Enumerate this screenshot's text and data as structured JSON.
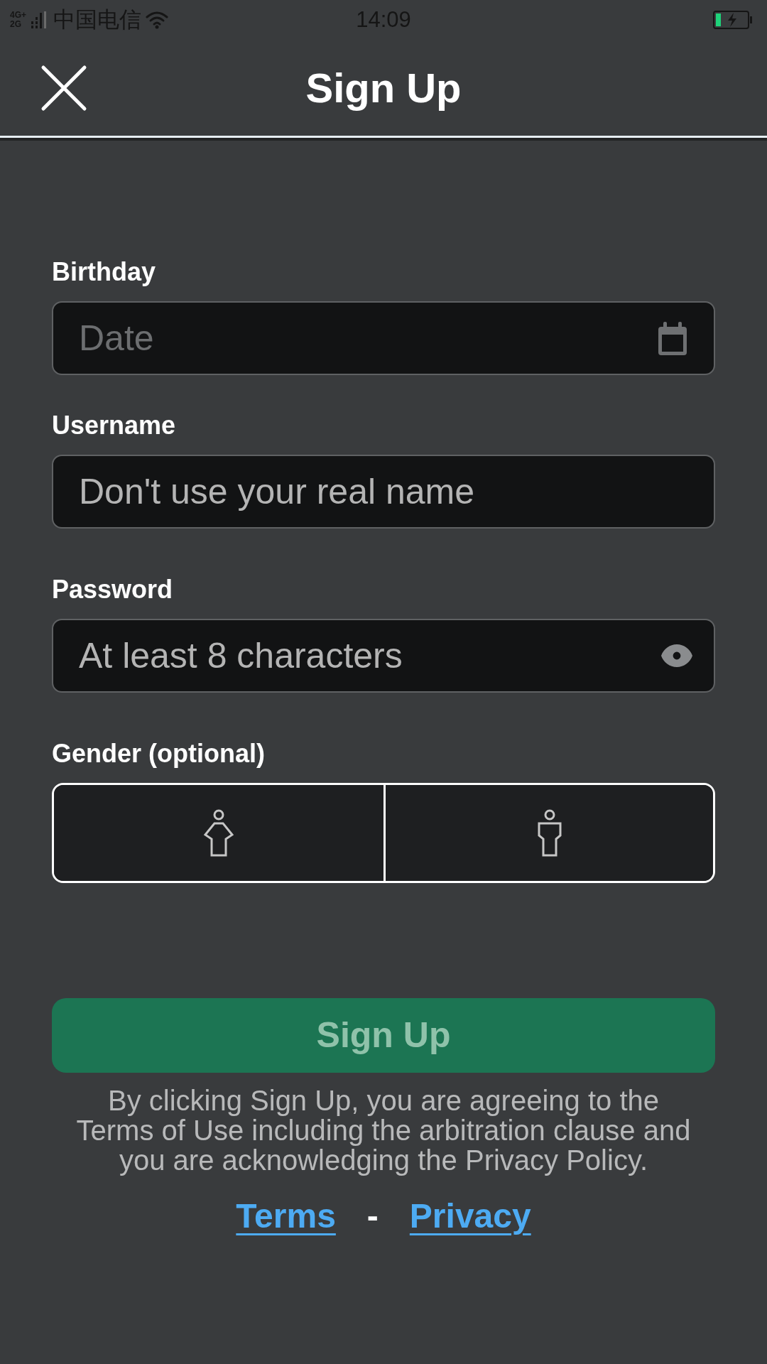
{
  "status_bar": {
    "network_top": "4G+",
    "network_bottom": "2G",
    "carrier": "中国电信",
    "time": "14:09"
  },
  "header": {
    "title": "Sign Up"
  },
  "fields": [
    {
      "kind": "date",
      "label": "Birthday",
      "placeholder": "Date"
    },
    {
      "kind": "text",
      "label": "Username",
      "placeholder": "Don't use your real name"
    },
    {
      "kind": "password",
      "label": "Password",
      "placeholder": "At least 8 characters"
    }
  ],
  "gender": {
    "label": "Gender (optional)",
    "options": [
      {
        "kind": "female",
        "selected": false
      },
      {
        "kind": "male",
        "selected": false
      }
    ]
  },
  "submit": {
    "label": "Sign Up",
    "disabled": true
  },
  "disclaimer": "By clicking Sign Up, you are agreeing to the Terms of Use including the arbitration clause and you are acknowledging the Privacy Policy.",
  "links": [
    {
      "label": "Terms"
    },
    {
      "label": "Privacy"
    }
  ],
  "link_separator": "-"
}
